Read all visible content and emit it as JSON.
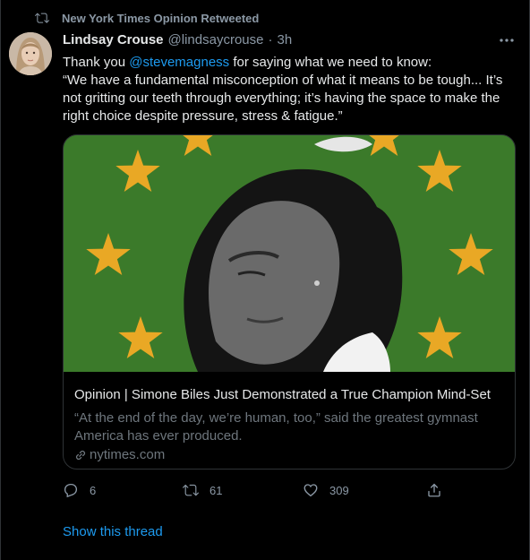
{
  "retweet_context": {
    "text": "New York Times Opinion Retweeted",
    "icon": "retweet-icon"
  },
  "tweet": {
    "author_name": "Lindsay Crouse",
    "author_handle": "@lindsaycrouse",
    "separator": "·",
    "time": "3h",
    "text_prefix": "Thank you ",
    "mention": "@stevemagness",
    "text_suffix": " for saying what we need to know:",
    "quote": "“We have a fundamental misconception of what it means to be tough... It’s not gritting our teeth through everything; it’s having the space to make the right choice despite pressure, stress & fatigue.”"
  },
  "card": {
    "title": "Opinion | Simone Biles Just Demonstrated a True Champion Mind-Set",
    "description": "“At the end of the day, we’re human, too,” said the greatest gymnast America has ever produced.",
    "domain": "nytimes.com",
    "image_background": "#3b7a2a",
    "star_color": "#e9a825"
  },
  "actions": {
    "reply_count": "6",
    "retweet_count": "61",
    "like_count": "309"
  },
  "show_thread": "Show this thread",
  "colors": {
    "accent": "#1d9bf0",
    "muted": "#8b98a5",
    "background": "#000000"
  }
}
